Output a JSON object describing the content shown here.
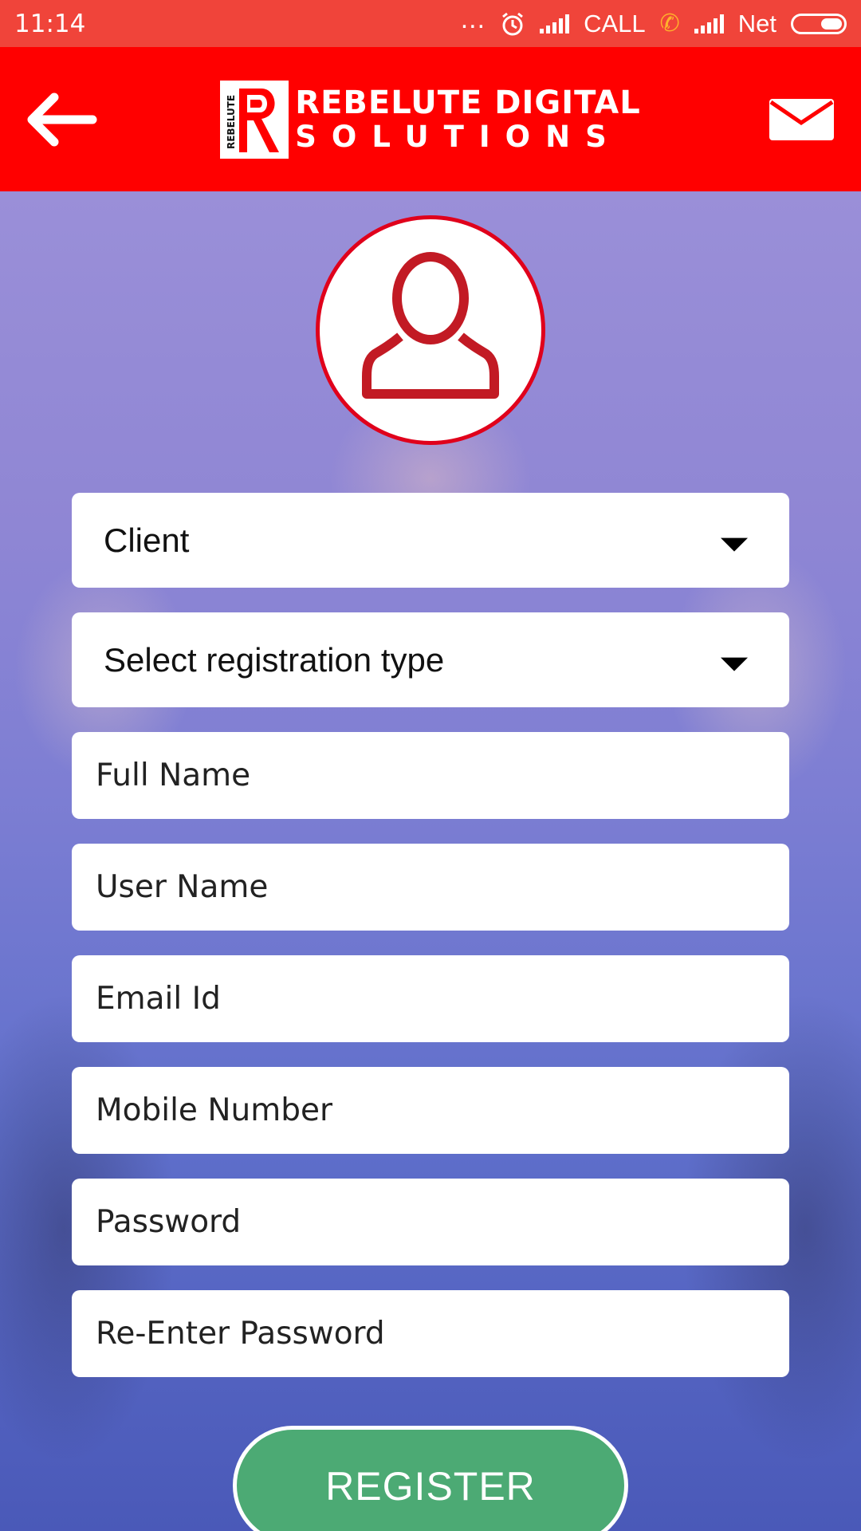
{
  "status_bar": {
    "time": "11:14",
    "dots": "...",
    "call_label": "CALL",
    "net_label": "Net"
  },
  "app_bar": {
    "logo_line1": "REBELUTE DIGITAL",
    "logo_line2": "SOLUTIONS",
    "logo_mark_text": "REBELUTE",
    "back_icon": "arrow-left-icon",
    "mail_icon": "mail-icon",
    "color": "#ff0000"
  },
  "avatar": {
    "icon": "user-icon",
    "border_color": "#e0001b"
  },
  "form": {
    "user_type": "Client",
    "registration_type": "Select registration type",
    "full_name_placeholder": "Full Name",
    "user_name_placeholder": "User Name",
    "email_placeholder": "Email Id",
    "mobile_placeholder": "Mobile Number",
    "password_placeholder": "Password",
    "reenter_password_placeholder": "Re-Enter Password"
  },
  "register_button": {
    "label": "REGISTER",
    "color": "#4caa74"
  }
}
